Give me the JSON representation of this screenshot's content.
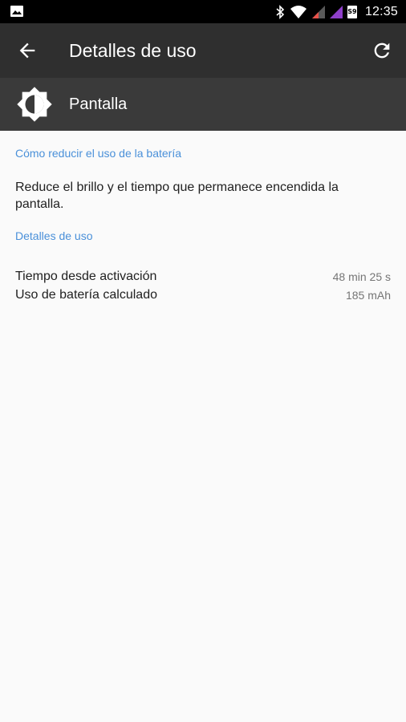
{
  "status_bar": {
    "time": "12:35",
    "sim_badge": "S9",
    "icons": [
      "image-icon",
      "bluetooth-icon",
      "wifi-icon",
      "signal-icon",
      "signal-icon",
      "battery-icon"
    ]
  },
  "toolbar": {
    "title": "Detalles de uso",
    "back_icon": "arrow-back-icon",
    "refresh_icon": "refresh-icon"
  },
  "header": {
    "icon": "brightness-icon",
    "label": "Pantalla"
  },
  "tips_section": {
    "title": "Cómo reducir el uso de la batería",
    "description": "Reduce el brillo y el tiempo que permanece encendida la pantalla."
  },
  "usage_section": {
    "title": "Detalles de uso",
    "rows": [
      {
        "label": "Tiempo desde activación",
        "value": "48 min 25 s"
      },
      {
        "label": "Uso de batería calculado",
        "value": "185 mAh"
      }
    ]
  },
  "colors": {
    "accent": "#4a90d9",
    "toolbar": "#2f2f2f",
    "header": "#3a3a3a",
    "background": "#fafafa"
  }
}
